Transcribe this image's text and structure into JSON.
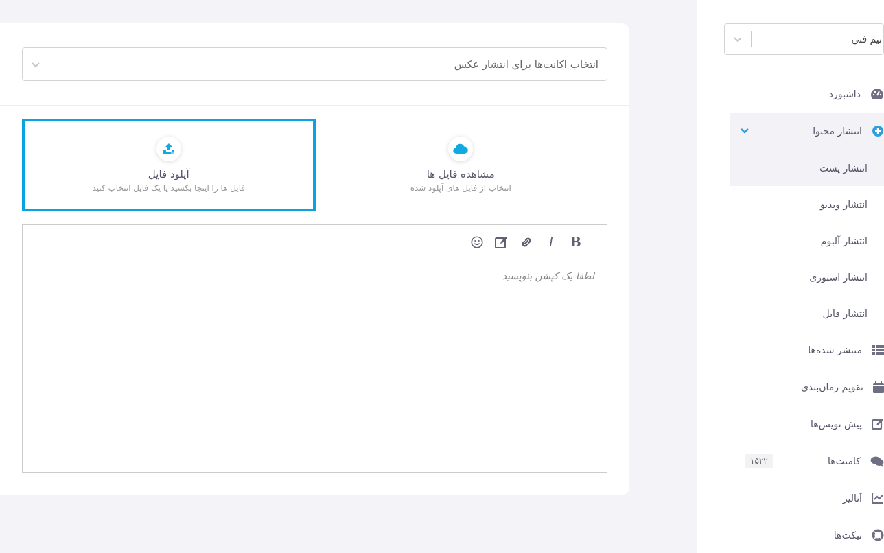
{
  "main": {
    "account_select": {
      "placeholder": "انتخاب اکانت‌ها برای انتشار عکس"
    },
    "sources": [
      {
        "kind": "library",
        "title": "مشاهده فایل ها",
        "subtitle": "انتخاب از فایل های آپلود شده",
        "selected": false
      },
      {
        "kind": "upload",
        "title": "آپلود فایل",
        "subtitle": "فایل ها را اینجا بکشید یا یک فایل انتخاب کنید",
        "selected": true
      }
    ],
    "editor": {
      "toolbar": [
        {
          "kind": "bold",
          "label": "B"
        },
        {
          "kind": "italic",
          "label": "I"
        },
        {
          "kind": "link"
        },
        {
          "kind": "edit"
        },
        {
          "kind": "emoji"
        }
      ],
      "placeholder": "لطفا یک کپشن بنویسید"
    }
  },
  "sidebar": {
    "team_select": {
      "value": "تیم فنی"
    },
    "items": [
      {
        "kind": "dashboard",
        "label": "داشبورد"
      },
      {
        "kind": "publish",
        "label": "انتشار محتوا",
        "expanded": true,
        "children": [
          {
            "label": "انتشار پست",
            "selected": true
          },
          {
            "label": "انتشار ویدیو",
            "selected": false
          },
          {
            "label": "انتشار آلبوم",
            "selected": false
          },
          {
            "label": "انتشار استوری",
            "selected": false
          },
          {
            "label": "انتشار فایل",
            "selected": false
          }
        ]
      },
      {
        "kind": "published",
        "label": "منتشر شده‌ها"
      },
      {
        "kind": "calendar",
        "label": "تقویم زمان‌بندی"
      },
      {
        "kind": "drafts",
        "label": "پیش نویس‌ها"
      },
      {
        "kind": "comments",
        "label": "کامنت‌ها",
        "badge": "۱۵۲۲"
      },
      {
        "kind": "analytics",
        "label": "آنالیز"
      },
      {
        "kind": "tickets",
        "label": "تیکت‌ها"
      }
    ]
  }
}
